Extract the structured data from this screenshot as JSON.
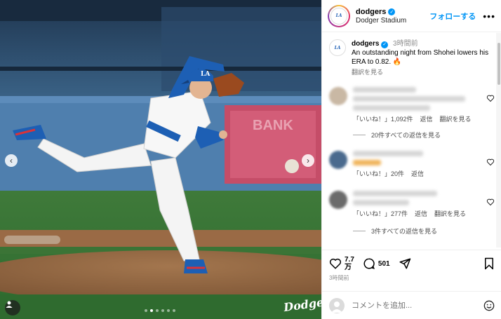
{
  "photo": {
    "carousel_dots": 6,
    "active_dot": 1,
    "watermark": "Dodgers"
  },
  "header": {
    "username": "dodgers",
    "location": "Dodger Stadium",
    "follow_label": "フォローする",
    "more_label": "•••"
  },
  "caption": {
    "username": "dodgers",
    "time": "3時間前",
    "text": "An outstanding night from Shohei lowers his ERA to 0.82. 🔥",
    "translate": "翻訳を見る"
  },
  "comments": [
    {
      "likes": "「いいね！」1,092件",
      "reply": "返信",
      "translate": "翻訳を見る",
      "replies": "20件すべての返信を見る"
    },
    {
      "likes": "「いいね！」20件",
      "reply": "返信"
    },
    {
      "likes": "「いいね！」277件",
      "reply": "返信",
      "translate": "翻訳を見る",
      "replies": "3件すべての返信を見る"
    }
  ],
  "actions": {
    "like_count": "7.7\n万",
    "comment_count": "501",
    "timestamp": "3時間前"
  },
  "comment_box": {
    "placeholder": "コメントを追加..."
  },
  "colors": {
    "accent": "#0095f6",
    "dodger_blue": "#1d5fb4"
  }
}
